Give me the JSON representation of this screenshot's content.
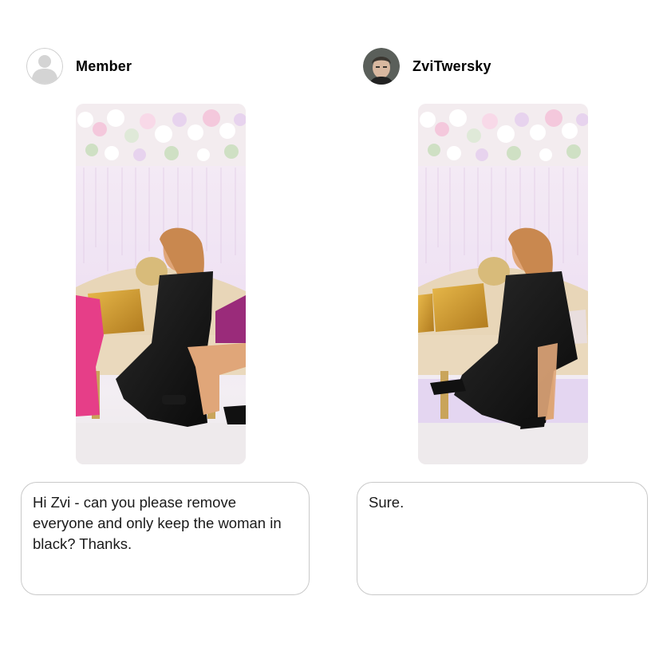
{
  "left": {
    "username": "Member",
    "avatar_icon": "generic-user-avatar-icon",
    "message": "Hi Zvi - can you please remove everyone and only keep the woman in black? Thanks."
  },
  "right": {
    "username": "ZviTwersky",
    "avatar_icon": "profile-photo-avatar",
    "message": "Sure."
  },
  "colors": {
    "border": "#c9c9c9",
    "avatar_placeholder": "#d6d6d6",
    "dress": "#111111",
    "sofa": "#e8d6b8",
    "flowers": "#f2e6f2"
  }
}
